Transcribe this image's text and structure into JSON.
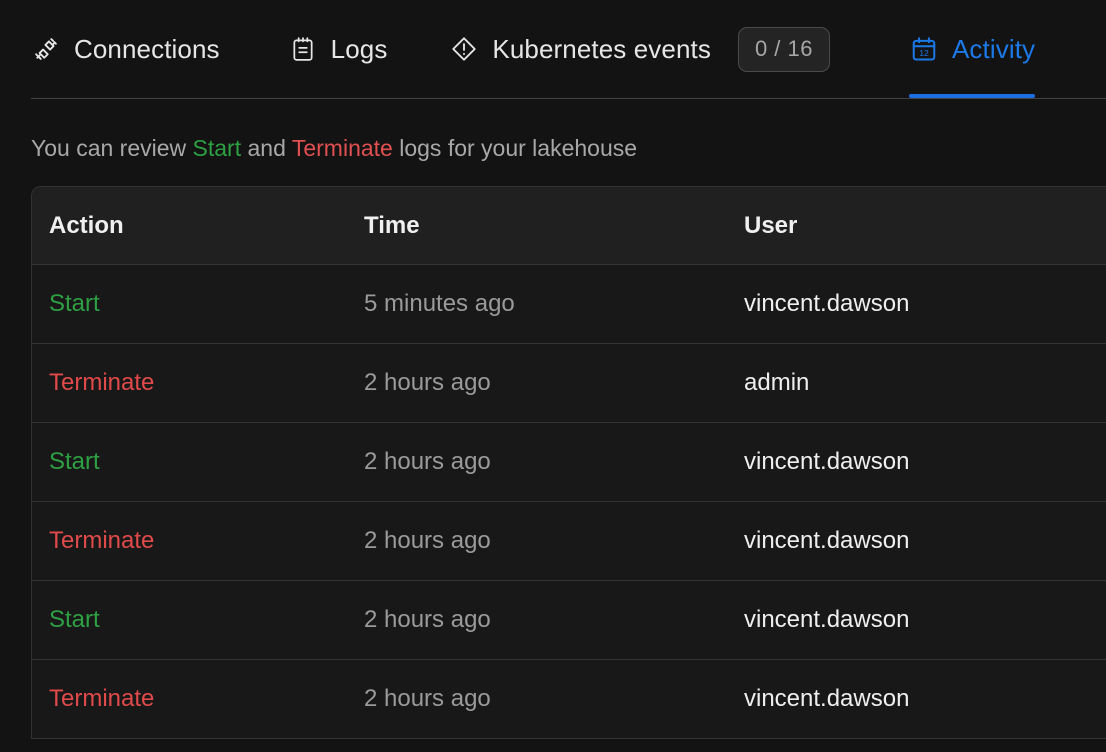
{
  "colors": {
    "accent": "#1c79e8",
    "start_green": "#2ea043",
    "terminate_red": "#e04a4a",
    "page_bg": "#131313",
    "table_bg": "#181818",
    "header_bg": "#202020",
    "border": "#333333"
  },
  "tabs": [
    {
      "id": "connections",
      "label": "Connections",
      "icon": "plug-connection-icon",
      "active": false
    },
    {
      "id": "logs",
      "label": "Logs",
      "icon": "notepad-icon",
      "active": false
    },
    {
      "id": "kubernetes-events",
      "label": "Kubernetes events",
      "icon": "diamond-alert-icon",
      "active": false,
      "badge": "0 / 16"
    },
    {
      "id": "activity",
      "label": "Activity",
      "icon": "calendar-icon",
      "icon_day": "12",
      "active": true
    }
  ],
  "subtitle": {
    "prefix": "You can review ",
    "start": "Start",
    "middle": " and ",
    "terminate": "Terminate",
    "suffix": " logs for your lakehouse"
  },
  "table": {
    "columns": [
      "Action",
      "Time",
      "User"
    ],
    "rows": [
      {
        "action": "Start",
        "action_type": "start",
        "time": "5 minutes ago",
        "user": "vincent.dawson"
      },
      {
        "action": "Terminate",
        "action_type": "terminate",
        "time": "2 hours ago",
        "user": "admin"
      },
      {
        "action": "Start",
        "action_type": "start",
        "time": "2 hours ago",
        "user": "vincent.dawson"
      },
      {
        "action": "Terminate",
        "action_type": "terminate",
        "time": "2 hours ago",
        "user": "vincent.dawson"
      },
      {
        "action": "Start",
        "action_type": "start",
        "time": "2 hours ago",
        "user": "vincent.dawson"
      },
      {
        "action": "Terminate",
        "action_type": "terminate",
        "time": "2 hours ago",
        "user": "vincent.dawson"
      }
    ]
  }
}
